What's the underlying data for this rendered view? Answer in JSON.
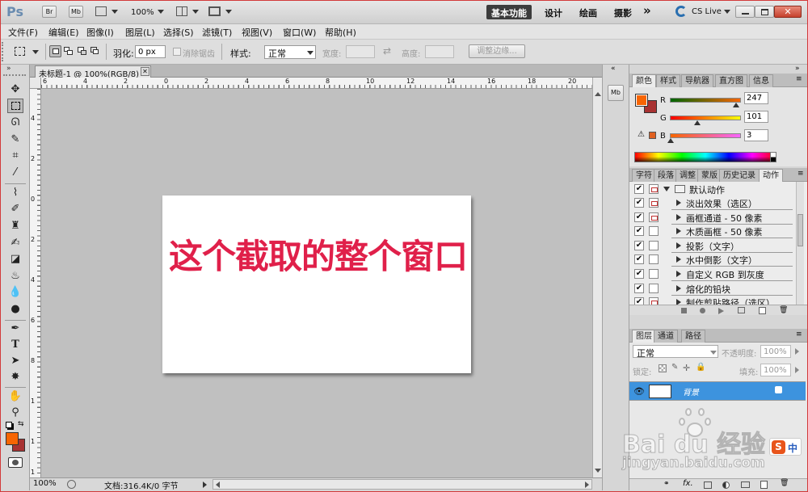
{
  "app": {
    "logo": "Ps",
    "bridge_label": "Br",
    "mini_bridge_label": "Mb",
    "zoom": "100%",
    "workspaces": [
      "基本功能",
      "设计",
      "绘画",
      "摄影"
    ],
    "more_label": "»",
    "cslive_label": "CS Live"
  },
  "menu": [
    "文件(F)",
    "编辑(E)",
    "图像(I)",
    "图层(L)",
    "选择(S)",
    "滤镜(T)",
    "视图(V)",
    "窗口(W)",
    "帮助(H)"
  ],
  "options": {
    "feather_label": "羽化:",
    "feather_value": "0 px",
    "antialias_label": "消除锯齿",
    "style_label": "样式:",
    "style_value": "正常",
    "width_label": "宽度:",
    "height_label": "高度:",
    "refine_edge_label": "调整边缘..."
  },
  "document": {
    "tab_title": "未标题-1 @ 100%(RGB/8)",
    "canvas_text": "这个截取的整个窗口",
    "canvas_text_color": "#e0204a",
    "ruler_h_labels": [
      "6",
      "4",
      "2",
      "0",
      "2",
      "4",
      "6",
      "8",
      "10",
      "12",
      "14",
      "16",
      "18",
      "20"
    ],
    "ruler_v_labels": [
      "4",
      "2",
      "0",
      "2",
      "4",
      "6",
      "8",
      "1",
      "1",
      "1"
    ]
  },
  "color_panel": {
    "tabs": [
      "颜色",
      "样式",
      "导航器",
      "直方图",
      "信息"
    ],
    "r": "247",
    "g": "101",
    "b": "3",
    "r_label": "R",
    "g_label": "G",
    "b_label": "B",
    "foreground": "#f76503",
    "background": "#a83232"
  },
  "actions_panel": {
    "tabs": [
      "字符",
      "段落",
      "调整",
      "蒙版",
      "历史记录",
      "动作"
    ],
    "set_name": "默认动作",
    "items": [
      {
        "label": "淡出效果（选区）",
        "dialog": true
      },
      {
        "label": "画框通道 - 50 像素",
        "dialog": true
      },
      {
        "label": "木质画框 - 50 像素",
        "dialog": false
      },
      {
        "label": "投影（文字）",
        "dialog": false
      },
      {
        "label": "水中倒影（文字）",
        "dialog": false
      },
      {
        "label": "自定义 RGB 到灰度",
        "dialog": false
      },
      {
        "label": "熔化的铅块",
        "dialog": false
      },
      {
        "label": "制作剪贴路径（选区）",
        "dialog": true
      }
    ]
  },
  "layers_panel": {
    "tabs": [
      "图层",
      "通道",
      "路径"
    ],
    "blend_mode": "正常",
    "opacity_label": "不透明度:",
    "opacity_value": "100%",
    "lock_label": "锁定:",
    "fill_label": "填充:",
    "fill_value": "100%",
    "layer_name": "背景"
  },
  "status": {
    "zoom": "100%",
    "doc_info": "文档:316.4K/0 字节"
  },
  "watermark": {
    "brand": "Bai du 经验",
    "url": "jingyan.baidu.com",
    "ime_label": "中"
  }
}
